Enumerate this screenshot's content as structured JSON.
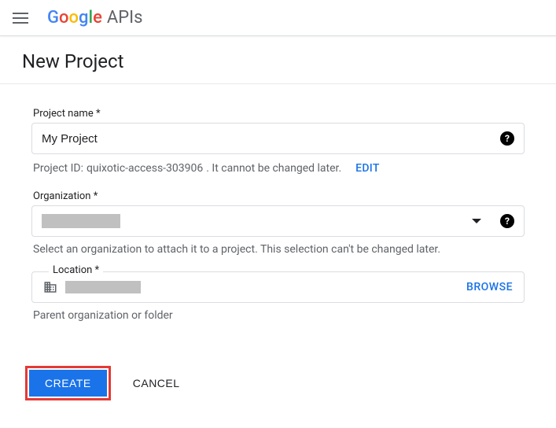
{
  "header": {
    "product_suffix": "APIs"
  },
  "page": {
    "title": "New Project"
  },
  "form": {
    "project_name": {
      "label": "Project name *",
      "value": "My Project"
    },
    "project_id": {
      "prefix": "Project ID: ",
      "id": "quixotic-access-303906",
      "suffix": ". It cannot be changed later.",
      "edit_label": "EDIT"
    },
    "organization": {
      "label": "Organization *",
      "helper": "Select an organization to attach it to a project. This selection can't be changed later."
    },
    "location": {
      "label": "Location *",
      "browse_label": "BROWSE",
      "helper": "Parent organization or folder"
    }
  },
  "actions": {
    "create": "CREATE",
    "cancel": "CANCEL"
  }
}
